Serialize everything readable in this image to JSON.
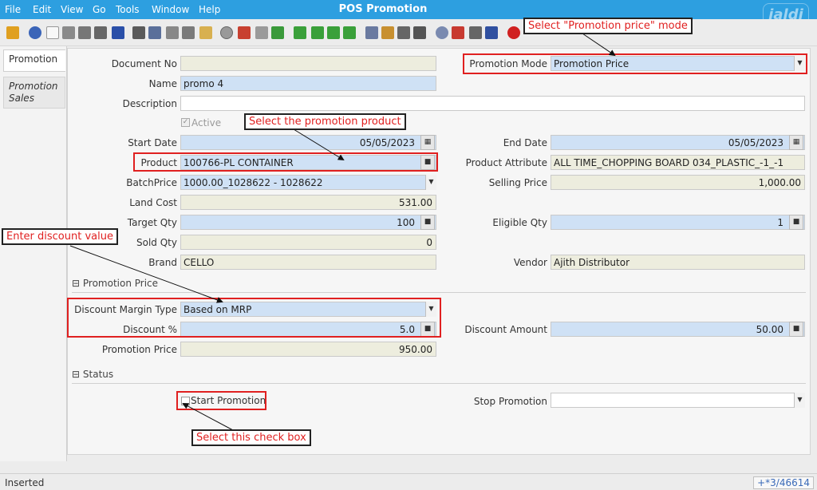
{
  "window": {
    "title": "POS Promotion",
    "logo": "jaldi"
  },
  "menu": [
    "File",
    "Edit",
    "View",
    "Go",
    "Tools",
    "Window",
    "Help"
  ],
  "tabs": {
    "promotion": "Promotion",
    "promotion_sales_1": "Promotion",
    "promotion_sales_2": "Sales"
  },
  "form": {
    "document_no": {
      "label": "Document No",
      "value": ""
    },
    "name": {
      "label": "Name",
      "value": "promo 4"
    },
    "description": {
      "label": "Description",
      "value": ""
    },
    "active": {
      "label": "Active",
      "checked": true
    },
    "start_date": {
      "label": "Start Date",
      "value": "05/05/2023"
    },
    "product": {
      "label": "Product",
      "value": "100766-PL CONTAINER"
    },
    "batch_price": {
      "label": "BatchPrice",
      "value": "1000.00_1028622 - 1028622"
    },
    "land_cost": {
      "label": "Land Cost",
      "value": "531.00"
    },
    "target_qty": {
      "label": "Target Qty",
      "value": "100"
    },
    "sold_qty": {
      "label": "Sold Qty",
      "value": "0"
    },
    "brand": {
      "label": "Brand",
      "value": "CELLO"
    },
    "promotion_mode": {
      "label": "Promotion Mode",
      "value": "Promotion Price"
    },
    "end_date": {
      "label": "End Date",
      "value": "05/05/2023"
    },
    "product_attribute": {
      "label": "Product Attribute",
      "value": "ALL TIME_CHOPPING BOARD 034_PLASTIC_-1_-1"
    },
    "selling_price": {
      "label": "Selling Price",
      "value": "1,000.00"
    },
    "eligible_qty": {
      "label": "Eligible Qty",
      "value": "1"
    },
    "vendor": {
      "label": "Vendor",
      "value": "Ajith Distributor"
    }
  },
  "promotion_price_section": {
    "title": "Promotion Price",
    "discount_margin_type": {
      "label": "Discount Margin Type",
      "value": "Based on MRP"
    },
    "discount_pct": {
      "label": "Discount %",
      "value": "5.0"
    },
    "discount_amount": {
      "label": "Discount Amount",
      "value": "50.00"
    },
    "promotion_price": {
      "label": "Promotion Price",
      "value": "950.00"
    }
  },
  "status_section": {
    "title": "Status",
    "start_promotion": {
      "label": "Start Promotion",
      "checked": false
    },
    "stop_promotion": {
      "label": "Stop Promotion",
      "value": ""
    }
  },
  "callouts": {
    "mode": "Select \"Promotion price\" mode",
    "product": "Select the promotion product",
    "discount": "Enter discount value",
    "checkbox": "Select this check box"
  },
  "statusbar": {
    "left": "Inserted",
    "right": "+*3/46614"
  },
  "colors": {
    "menubar": "#2d9fe0",
    "mandatory": "#cfe1f5",
    "readonly": "#ededde",
    "annotation": "#e02020"
  }
}
